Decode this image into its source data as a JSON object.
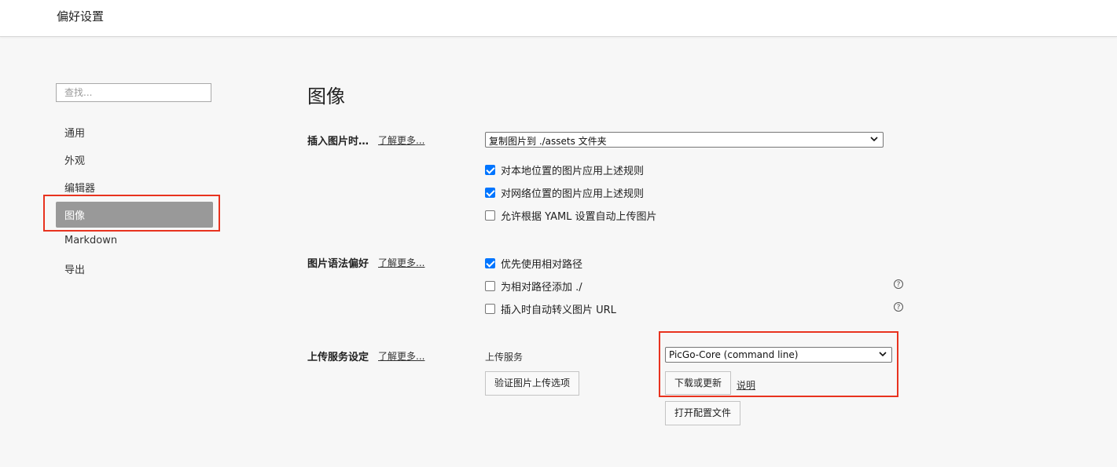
{
  "window": {
    "title": "偏好设置"
  },
  "sidebar": {
    "search_placeholder": "查找...",
    "items": [
      {
        "label": "通用"
      },
      {
        "label": "外观"
      },
      {
        "label": "编辑器"
      },
      {
        "label": "图像"
      },
      {
        "label": "Markdown"
      },
      {
        "label": "导出"
      }
    ],
    "active": "图像"
  },
  "main": {
    "title": "图像",
    "learn_more": "了解更多...",
    "insert": {
      "label": "插入图片时…",
      "select_value": "复制图片到 ./assets 文件夹",
      "options": [
        {
          "label": "对本地位置的图片应用上述规则",
          "checked": true
        },
        {
          "label": "对网络位置的图片应用上述规则",
          "checked": true
        },
        {
          "label": "允许根据 YAML 设置自动上传图片",
          "checked": false
        }
      ]
    },
    "syntax": {
      "label": "图片语法偏好",
      "options": [
        {
          "label": "优先使用相对路径",
          "checked": true
        },
        {
          "label": "为相对路径添加 ./",
          "checked": false
        },
        {
          "label": "插入时自动转义图片 URL",
          "checked": false
        }
      ],
      "help_glyph": "?"
    },
    "upload": {
      "label": "上传服务设定",
      "service_label": "上传服务",
      "service_value": "PicGo-Core (command line)",
      "verify_button": "验证图片上传选项",
      "download_button": "下载或更新",
      "docs_link": "说明",
      "open_config_button": "打开配置文件"
    }
  },
  "colors": {
    "highlight": "#e8331f",
    "checkbox": "#0075ff",
    "active_nav": "#999999"
  }
}
